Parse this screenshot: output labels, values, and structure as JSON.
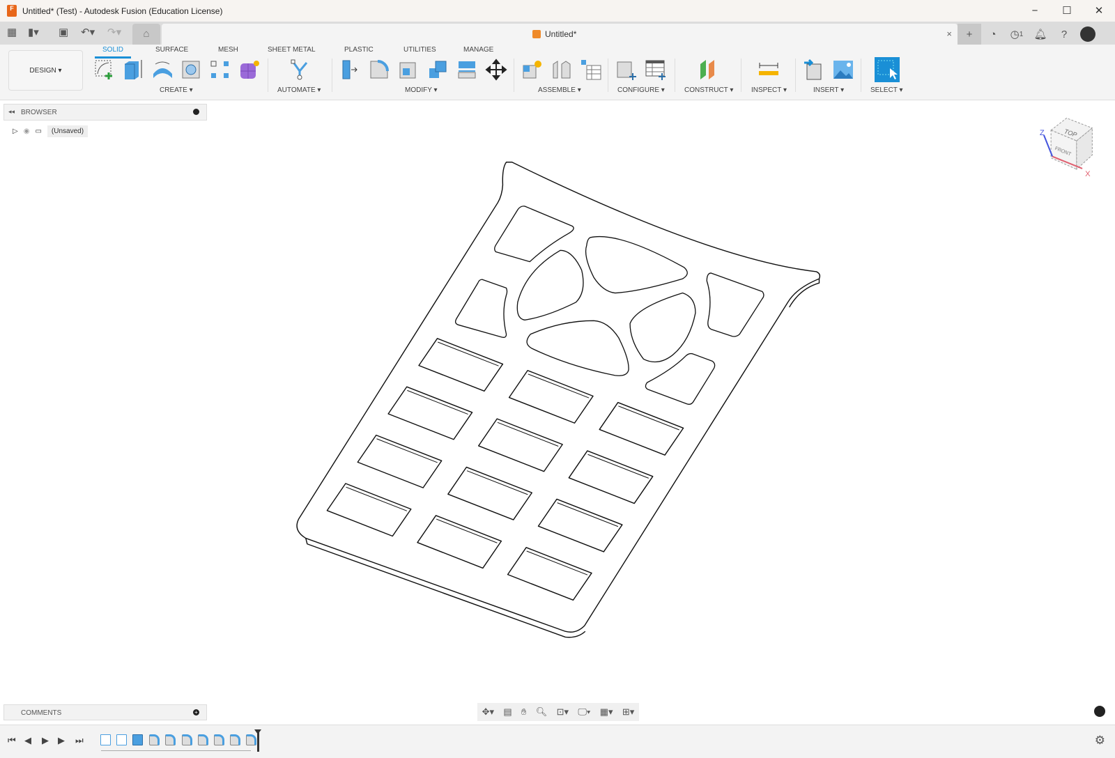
{
  "window": {
    "title": "Untitled* (Test) - Autodesk Fusion (Education License)",
    "minimize": "−",
    "maximize": "☐",
    "close": "✕"
  },
  "quickbar": {
    "doc_tab": "Untitled*",
    "doc_close": "×",
    "job_count": "1"
  },
  "ribbon": {
    "workspace": "DESIGN ▾",
    "tabs": [
      "SOLID",
      "SURFACE",
      "MESH",
      "SHEET METAL",
      "PLASTIC",
      "UTILITIES",
      "MANAGE"
    ],
    "groups": [
      "CREATE ▾",
      "AUTOMATE ▾",
      "MODIFY ▾",
      "ASSEMBLE ▾",
      "CONFIGURE ▾",
      "CONSTRUCT ▾",
      "INSPECT ▾",
      "INSERT ▾",
      "SELECT ▾"
    ]
  },
  "browser": {
    "title": "BROWSER",
    "root": "(Unsaved)"
  },
  "comments": {
    "title": "COMMENTS"
  },
  "viewcube": {
    "top": "TOP",
    "front": "FRONT",
    "x": "X",
    "z": "Z"
  },
  "accent": "#1a8fd6"
}
